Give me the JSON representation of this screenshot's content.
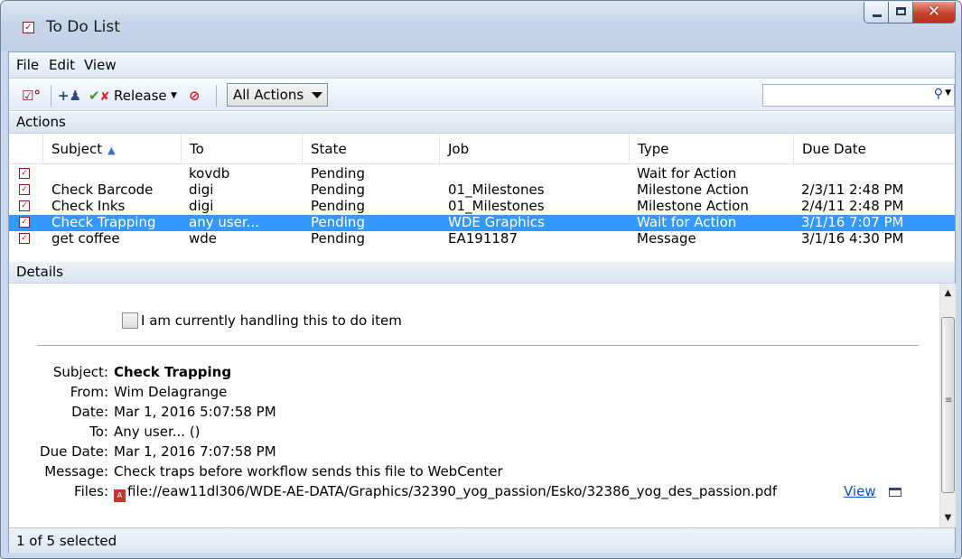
{
  "window": {
    "title": "To Do List"
  },
  "menu": {
    "items": [
      "File",
      "Edit",
      "View"
    ]
  },
  "toolbar": {
    "release_label": "Release",
    "filter_selected": "All Actions",
    "search_placeholder": ""
  },
  "actions": {
    "section_title": "Actions",
    "columns": [
      "Subject",
      "To",
      "State",
      "Job",
      "Type",
      "Due Date"
    ],
    "sort_column": "Subject",
    "sort_direction": "ascending",
    "rows": [
      {
        "subject": "",
        "to": "kovdb",
        "state": "Pending",
        "job": "",
        "type": "Wait for Action",
        "due": "",
        "selected": false
      },
      {
        "subject": "Check Barcode",
        "to": "digi",
        "state": "Pending",
        "job": "01_Milestones",
        "type": "Milestone Action",
        "due": "2/3/11 2:48 PM",
        "selected": false
      },
      {
        "subject": "Check Inks",
        "to": "digi",
        "state": "Pending",
        "job": "01_Milestones",
        "type": "Milestone Action",
        "due": "2/4/11 2:48 PM",
        "selected": false
      },
      {
        "subject": "Check Trapping",
        "to": "any user...",
        "state": "Pending",
        "job": "WDE Graphics",
        "type": "Wait for Action",
        "due": "3/1/16 7:07 PM",
        "selected": true
      },
      {
        "subject": "get coffee",
        "to": "wde",
        "state": "Pending",
        "job": "EA191187",
        "type": "Message",
        "due": "3/1/16 4:30 PM",
        "selected": false
      }
    ]
  },
  "details": {
    "section_title": "Details",
    "handling_checkbox_label": "I am currently handling this to do item",
    "handling_checked": false,
    "fields": {
      "subject_label": "Subject:",
      "subject": "Check Trapping",
      "from_label": "From:",
      "from": "Wim Delagrange",
      "date_label": "Date:",
      "date": "Mar 1, 2016 5:07:58 PM",
      "to_label": "To:",
      "to": "Any user... ()",
      "due_label": "Due Date:",
      "due": "Mar 1, 2016 7:07:58 PM",
      "message_label": "Message:",
      "message": "Check traps before workflow sends this file to WebCenter",
      "files_label": "Files:",
      "file_path": "file://eaw11dl306/WDE-AE-DATA/Graphics/32390_yog_passion/Esko/32386_yog_des_passion.pdf",
      "view_link": "View"
    }
  },
  "status": {
    "text": "1 of 5 selected"
  }
}
